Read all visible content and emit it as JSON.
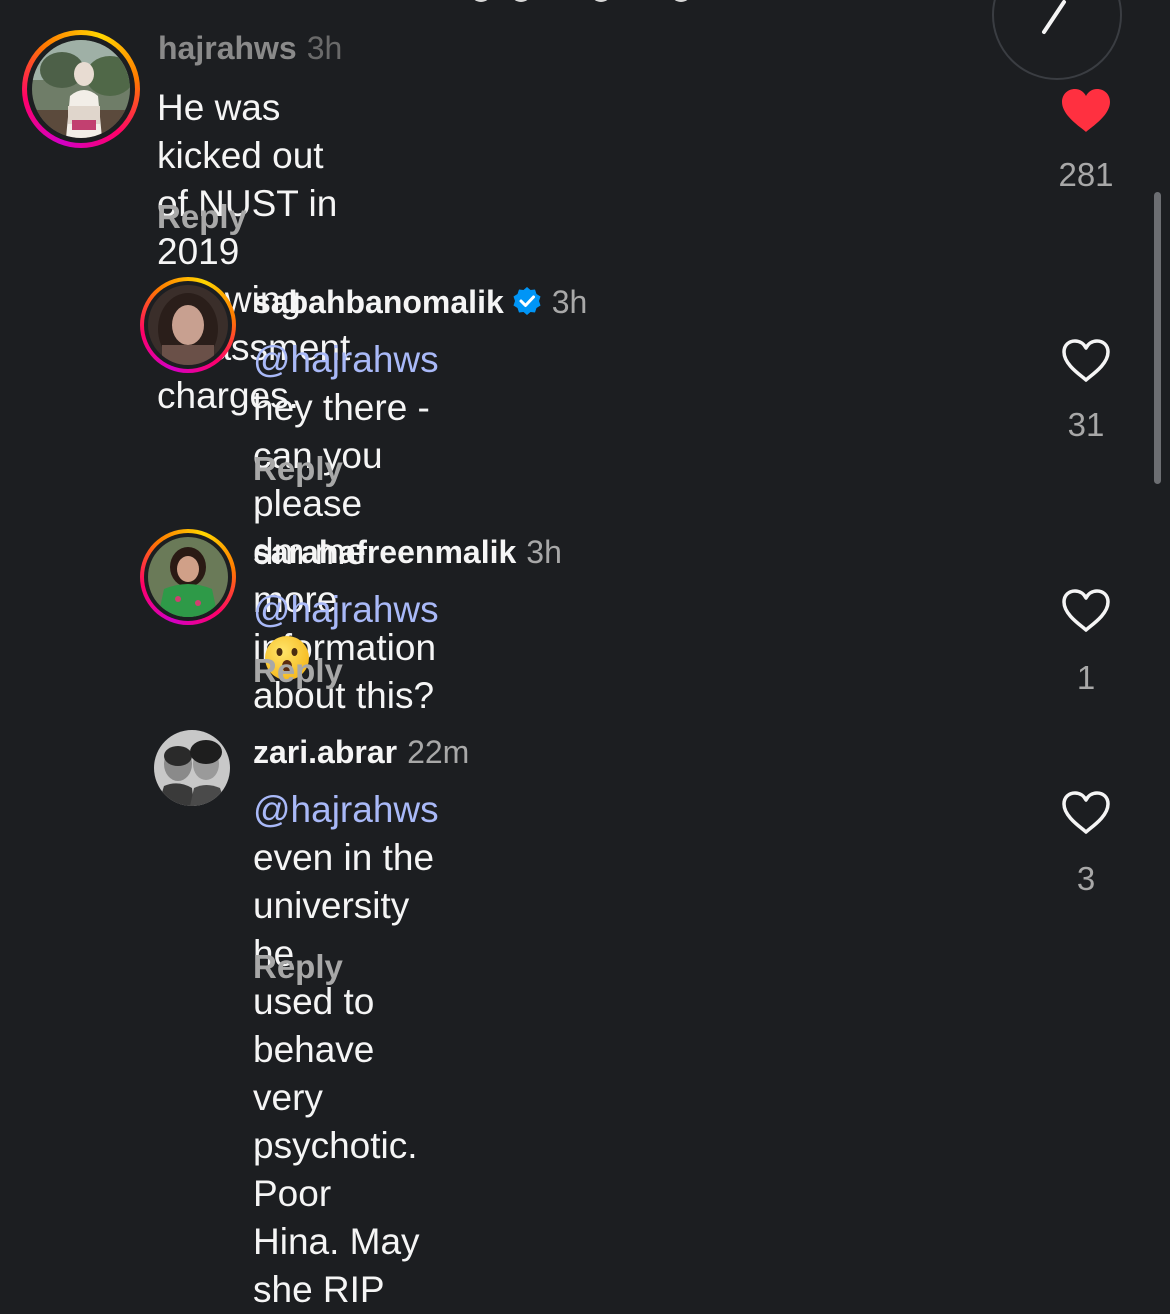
{
  "theme": {
    "background": "#1c1e21",
    "text": "#f5f5f5",
    "secondary": "#a8a8a8",
    "mention": "#a9b9f8",
    "like_active": "#ff3040",
    "verified": "#0095f6"
  },
  "comments": [
    {
      "username": "hajrahws",
      "time": "3h",
      "mention": "",
      "text_line1": "He was kicked out of NUST in 2019",
      "text_line2": "following harassment charges.",
      "reply_label": "Reply",
      "likes": "281",
      "liked": true,
      "like_icon": "heart-filled-icon"
    },
    {
      "username": "sabahbanomalik",
      "verified": true,
      "time": "3h",
      "mention": "@hajrahws",
      "text_line1": " hey there - can you please",
      "text_line2": "dm me more information about this?",
      "reply_label": "Reply",
      "likes": "31",
      "liked": false,
      "like_icon": "heart-outline-icon"
    },
    {
      "username": "sarahafreenmalik",
      "time": "3h",
      "mention": "@hajrahws",
      "emoji": "😮",
      "emoji_name": "astonished-face-emoji",
      "reply_label": "Reply",
      "likes": "1",
      "liked": false,
      "like_icon": "heart-outline-icon"
    },
    {
      "username": "zari.abrar",
      "time": "22m",
      "mention": "@hajrahws",
      "text_line1": " even in the university he",
      "text_line2": "used to behave very psychotic. Poor",
      "text_line3": "Hina. May she RIP",
      "reply_label": "Reply",
      "likes": "3",
      "liked": false,
      "like_icon": "heart-outline-icon"
    }
  ]
}
